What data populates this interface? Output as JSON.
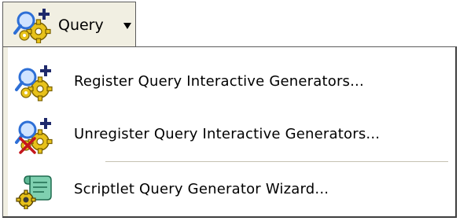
{
  "toolbar": {
    "query_button": {
      "label": "Query",
      "icon": "query-generator-icon",
      "arrow_icon": "dropdown-arrow-icon"
    }
  },
  "menu": {
    "items": [
      {
        "label": "Register Query Interactive Generators...",
        "icon": "register-generator-icon"
      },
      {
        "label": "Unregister Query Interactive Generators...",
        "icon": "unregister-generator-icon"
      },
      {
        "label": "Scriptlet Query Generator Wizard...",
        "icon": "scriptlet-wizard-icon"
      }
    ]
  },
  "colors": {
    "button_background": "#f1efe2",
    "border": "#5c5c5c",
    "menu_background": "#ffffff",
    "separator": "#c5c2b2",
    "magnifier_blue": "#2d6fd6",
    "gear_yellow": "#e8c21a",
    "plus_navy": "#1f2a6b",
    "cross_red": "#c4161c"
  }
}
